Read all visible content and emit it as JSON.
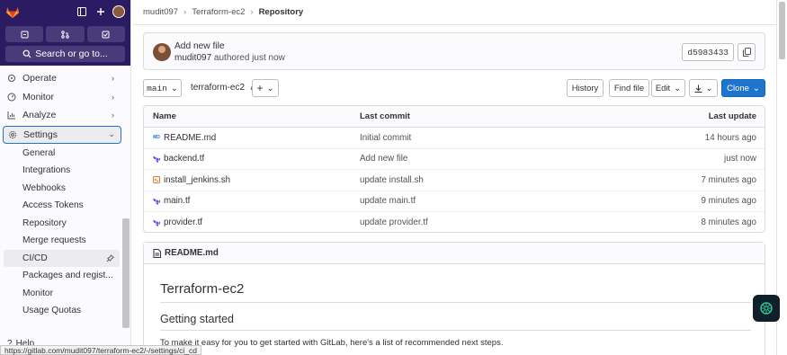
{
  "sidebar": {
    "search_label": "Search or go to...",
    "nav": [
      {
        "label": "Operate",
        "icon": "deployments-icon"
      },
      {
        "label": "Monitor",
        "icon": "monitor-icon"
      },
      {
        "label": "Analyze",
        "icon": "chart-icon"
      }
    ],
    "settings_label": "Settings",
    "settings_sub": [
      "General",
      "Integrations",
      "Webhooks",
      "Access Tokens",
      "Repository",
      "Merge requests",
      "CI/CD",
      "Packages and regist...",
      "Monitor",
      "Usage Quotas"
    ],
    "help_label": "Help"
  },
  "breadcrumb": {
    "user": "mudit097",
    "project": "Terraform-ec2",
    "current": "Repository"
  },
  "commit": {
    "title": "Add new file",
    "author": "mudit097",
    "authored": "authored just now",
    "sha": "d5983433"
  },
  "toolbar": {
    "branch": "main",
    "path": "terraform-ec2",
    "path_sep": "/",
    "add": "+",
    "history": "History",
    "find_file": "Find file",
    "edit": "Edit",
    "clone": "Clone"
  },
  "table": {
    "headers": {
      "name": "Name",
      "last_commit": "Last commit",
      "last_update": "Last update"
    },
    "rows": [
      {
        "name": "README.md",
        "commit": "Initial commit",
        "update": "14 hours ago",
        "icon": "markdown-icon"
      },
      {
        "name": "backend.tf",
        "commit": "Add new file",
        "update": "just now",
        "icon": "terraform-icon"
      },
      {
        "name": "install_jenkins.sh",
        "commit": "update install.sh",
        "update": "7 minutes ago",
        "icon": "shell-icon"
      },
      {
        "name": "main.tf",
        "commit": "update main.tf",
        "update": "9 minutes ago",
        "icon": "terraform-icon"
      },
      {
        "name": "provider.tf",
        "commit": "update provider.tf",
        "update": "8 minutes ago",
        "icon": "terraform-icon"
      }
    ]
  },
  "readme": {
    "file": "README.md",
    "h1": "Terraform-ec2",
    "h2": "Getting started",
    "p": "To make it easy for you to get started with GitLab, here's a list of recommended next steps."
  },
  "status_url": "https://gitlab.com/mudit097/terraform-ec2/-/settings/ci_cd",
  "colors": {
    "sidebar_top": "#2b1b63",
    "primary": "#1f75cb",
    "terraform": "#5c4ee5"
  }
}
